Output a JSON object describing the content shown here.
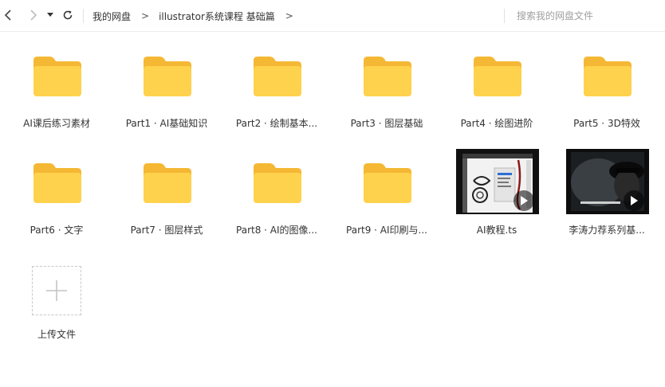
{
  "toolbar": {
    "breadcrumbs": [
      "我的网盘",
      "illustrator系统课程 基础篇"
    ],
    "separator": ">",
    "search_placeholder": "搜索我的网盘文件"
  },
  "items": [
    {
      "label": "AI课后练习素材",
      "type": "folder"
    },
    {
      "label": "Part1 · AI基础知识",
      "type": "folder"
    },
    {
      "label": "Part2 · 绘制基本...",
      "type": "folder"
    },
    {
      "label": "Part3 · 图层基础",
      "type": "folder"
    },
    {
      "label": "Part4 · 绘图进阶",
      "type": "folder"
    },
    {
      "label": "Part5 · 3D特效",
      "type": "folder"
    },
    {
      "label": "Part6 · 文字",
      "type": "folder"
    },
    {
      "label": "Part7 · 图层样式",
      "type": "folder"
    },
    {
      "label": "Part8 · AI的图像...",
      "type": "folder"
    },
    {
      "label": "Part9 · AI印刷与...",
      "type": "folder"
    },
    {
      "label": "AI教程.ts",
      "type": "video"
    },
    {
      "label": "李涛力荐系列基...",
      "type": "video"
    }
  ],
  "upload": {
    "label": "上传文件"
  },
  "colors": {
    "folder": "#FFD24D",
    "folder_tab": "#F5B834",
    "text": "#333333"
  }
}
